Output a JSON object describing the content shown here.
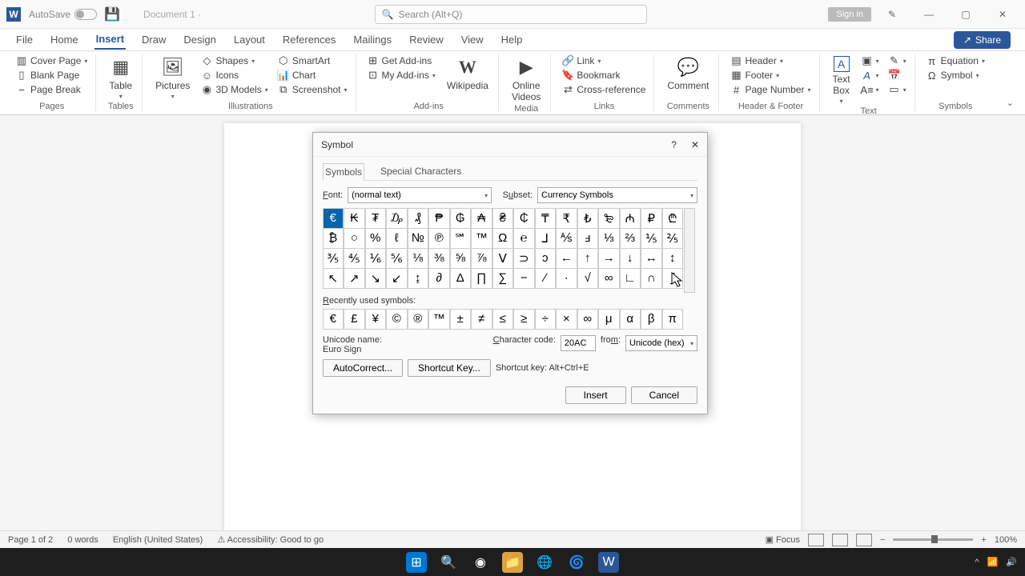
{
  "titlebar": {
    "autosave": "AutoSave",
    "docname": "Document 1 ·",
    "search_placeholder": "Search (Alt+Q)",
    "signin": "Sign in"
  },
  "tabs": [
    "File",
    "Home",
    "Insert",
    "Draw",
    "Design",
    "Layout",
    "References",
    "Mailings",
    "Review",
    "View",
    "Help"
  ],
  "active_tab": "Insert",
  "share": "Share",
  "ribbon": {
    "pages": {
      "cover": "Cover Page",
      "blank": "Blank Page",
      "break": "Page Break",
      "label": "Pages"
    },
    "tables": {
      "table": "Table",
      "label": "Tables"
    },
    "illus": {
      "pictures": "Pictures",
      "shapes": "Shapes",
      "icons": "Icons",
      "models": "3D Models",
      "smartart": "SmartArt",
      "chart": "Chart",
      "screenshot": "Screenshot",
      "label": "Illustrations"
    },
    "addins": {
      "get": "Get Add-ins",
      "my": "My Add-ins",
      "wiki": "Wikipedia",
      "label": "Add-ins"
    },
    "media": {
      "online": "Online\nVideos",
      "label": "Media"
    },
    "links": {
      "link": "Link",
      "bookmark": "Bookmark",
      "cross": "Cross-reference",
      "label": "Links"
    },
    "comments": {
      "comment": "Comment",
      "label": "Comments"
    },
    "hf": {
      "header": "Header",
      "footer": "Footer",
      "pagenum": "Page Number",
      "label": "Header & Footer"
    },
    "text": {
      "textbox": "Text\nBox",
      "label": "Text"
    },
    "symbols": {
      "equation": "Equation",
      "symbol": "Symbol",
      "label": "Symbols"
    }
  },
  "dialog": {
    "title": "Symbol",
    "tabs": [
      "Symbols",
      "Special Characters"
    ],
    "font_label": "Font:",
    "font_value": "(normal text)",
    "subset_label": "Subset:",
    "subset_value": "Currency Symbols",
    "grid": [
      [
        "€",
        "₭",
        "₮",
        "₯",
        "₰",
        "₱",
        "₲",
        "₳",
        "₴",
        "₵",
        "₸",
        "₹",
        "₺",
        "₻",
        "₼",
        "₽",
        "₾"
      ],
      [
        "₿",
        "○",
        "%",
        "ℓ",
        "№",
        "℗",
        "℠",
        "™",
        "Ω",
        "℮",
        "⅃",
        "⅍",
        "ⅎ",
        "⅓",
        "⅔",
        "⅕",
        "⅖"
      ],
      [
        "⅗",
        "⅘",
        "⅙",
        "⅚",
        "⅛",
        "⅜",
        "⅝",
        "⅞",
        "Ⅴ",
        "⊃",
        "ↄ",
        "←",
        "↑",
        "→",
        "↓",
        "↔",
        "↕"
      ],
      [
        "↖",
        "↗",
        "↘",
        "↙",
        "↨",
        "∂",
        "Δ",
        "∏",
        "∑",
        "−",
        "∕",
        "∙",
        "√",
        "∞",
        "∟",
        "∩",
        "∫"
      ]
    ],
    "recent_label": "Recently used symbols:",
    "recent": [
      "€",
      "£",
      "¥",
      "©",
      "®",
      "™",
      "±",
      "≠",
      "≤",
      "≥",
      "÷",
      "×",
      "∞",
      "μ",
      "α",
      "β",
      "π"
    ],
    "unicode_name_label": "Unicode name:",
    "unicode_name": "Euro Sign",
    "charcode_label": "Character code:",
    "charcode": "20AC",
    "from_label": "from:",
    "from": "Unicode (hex)",
    "autocorrect": "AutoCorrect...",
    "shortcutkey": "Shortcut Key...",
    "shortcut_text": "Shortcut key: Alt+Ctrl+E",
    "insert": "Insert",
    "cancel": "Cancel"
  },
  "status": {
    "page": "Page 1 of 2",
    "words": "0 words",
    "lang": "English (United States)",
    "access": "Accessibility: Good to go",
    "focus": "Focus",
    "zoom": "100%"
  }
}
